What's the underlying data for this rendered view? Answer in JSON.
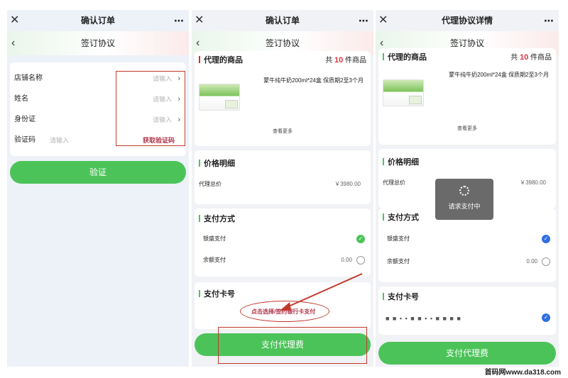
{
  "screens": [
    {
      "title": "确认订单",
      "subtitle": "签订协议",
      "close_icon": "✕",
      "back_icon": "‹",
      "more_icon": "⋯",
      "fields": [
        {
          "label": "店铺名称",
          "placeholder": "请输入"
        },
        {
          "label": "姓名",
          "placeholder": "请输入"
        },
        {
          "label": "身份证",
          "placeholder": "请输入"
        },
        {
          "label": "验证码",
          "placeholder": "请输入",
          "action": "获取验证码"
        }
      ],
      "button": "验证"
    },
    {
      "title": "确认订单",
      "subtitle": "签订协议",
      "close_icon": "✕",
      "back_icon": "‹",
      "more_icon": "⋯",
      "product_section": "代理的商品",
      "count_prefix": "共",
      "count": "10",
      "count_suffix": "件商品",
      "product_name": "蒙牛纯牛奶200ml*24盒 保质期2至3个月",
      "see_more": "查看更多",
      "price_section": "价格明细",
      "price_label": "代理总价",
      "price_value": "￥3980.00",
      "pay_section": "支付方式",
      "pay_methods": [
        {
          "label": "银盛支付",
          "selected": true
        },
        {
          "label": "余额支付",
          "amount": "0.00",
          "selected": false
        }
      ],
      "card_section": "支付卡号",
      "card_hint": "点击选择/签约银行卡支付",
      "button": "支付代理费"
    },
    {
      "title": "代理协议详情",
      "subtitle": "签订协议",
      "close_icon": "✕",
      "back_icon": "‹",
      "more_icon": "⋯",
      "product_section": "代理的商品",
      "count_prefix": "共",
      "count": "10",
      "count_suffix": "件商品",
      "product_name": "蒙牛纯牛奶200ml*24盒 保质期2至3个月",
      "see_more": "查看更多",
      "price_section": "价格明细",
      "price_label": "代理总价",
      "price_value": "￥3980.00",
      "loading_text": "请求支付中",
      "pay_section": "支付方式",
      "pay_methods": [
        {
          "label": "银盛支付",
          "selected": true
        },
        {
          "label": "余额支付",
          "amount": "0.00",
          "selected": false
        }
      ],
      "card_section": "支付卡号",
      "card_number": "■ ■ ▪ ▪ ■ ■ ▪ ▪ ■ ■   ■ ■",
      "button": "支付代理费"
    }
  ],
  "check_icon": "✓",
  "watermark": "首码网www.da318.com",
  "colors": {
    "accent": "#4cc359",
    "annotation": "#c0392b",
    "price": "#d9363e",
    "blue_check": "#2f6fe0"
  }
}
